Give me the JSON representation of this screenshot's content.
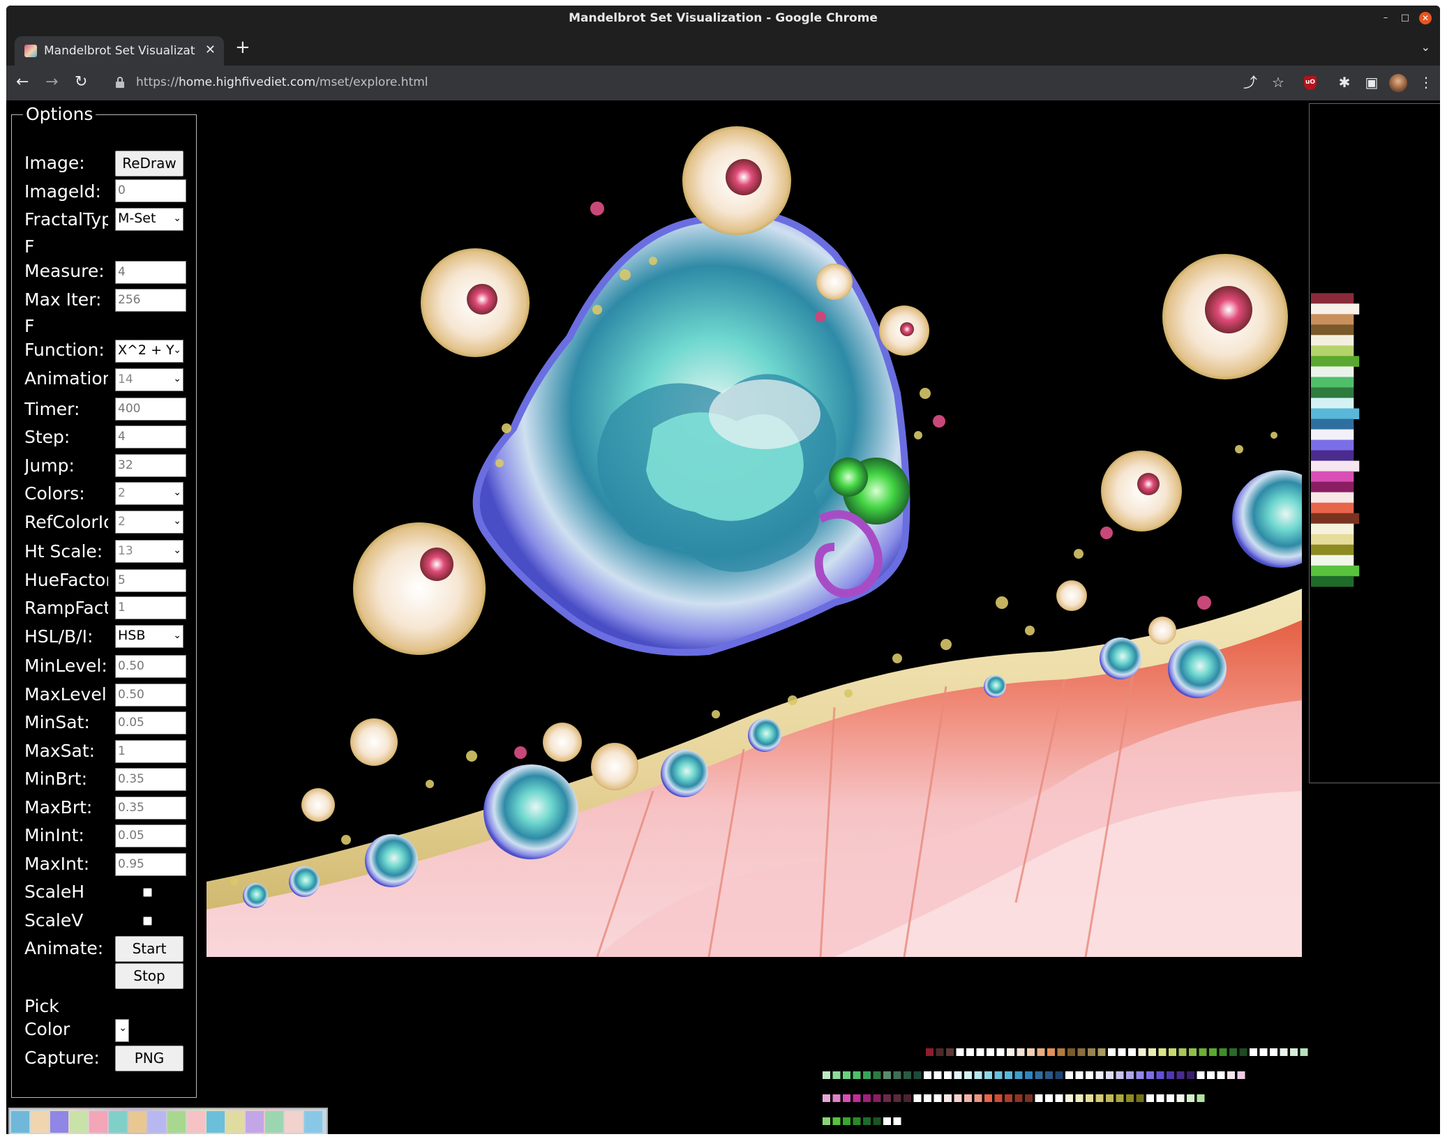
{
  "window": {
    "title": "Mandelbrot Set Visualization - Google Chrome",
    "controls": [
      "–",
      "□",
      "✕"
    ]
  },
  "tab": {
    "title": "Mandelbrot Set Visualizat",
    "close_glyph": "✕",
    "new_tab_glyph": "+",
    "menu_glyph": "⌄"
  },
  "toolbar": {
    "url_scheme": "https://",
    "url_host": "home.highfivediet.com",
    "url_path": "/mset/explore.html",
    "back_glyph": "←",
    "forward_glyph": "→",
    "reload_glyph": "↻",
    "share_glyph": "⤴",
    "star_glyph": "☆",
    "extensions_glyph": "✱",
    "sidepanel_glyph": "▣",
    "menu_glyph": "⋮",
    "ublock_text": "uO"
  },
  "options": {
    "legend": "Options",
    "image_label": "Image:",
    "redraw_label": "ReDraw",
    "image_id_label": "ImageId:",
    "image_id_value": "0",
    "fractal_type_label": "FractalType",
    "fractal_type_value": "M-Set",
    "f_measure_label_1": "F",
    "f_measure_label_2": "Measure:",
    "f_measure_value": "4",
    "max_iter_label": "Max Iter:",
    "max_iter_value": "256",
    "f_function_label_1": "F",
    "f_function_label_2": "Function:",
    "f_function_value": "X^2 + Y",
    "animation_label": "Animation",
    "animation_value": "14",
    "timer_label": "Timer:",
    "timer_value": "400",
    "step_label": "Step:",
    "step_value": "4",
    "jump_label": "Jump:",
    "jump_value": "32",
    "colors_label": "Colors:",
    "colors_value": "2",
    "ref_color_label": "RefColorId",
    "ref_color_value": "2",
    "ht_scale_label": "Ht Scale:",
    "ht_scale_value": "13",
    "hue_factor_label": "HueFactor",
    "hue_factor_value": "5",
    "ramp_factor_label": "RampFactor",
    "ramp_factor_value": "1",
    "hsl_label": "HSL/B/I:",
    "hsl_value": "HSB",
    "min_level_label": "MinLevel:",
    "min_level_value": "0.50",
    "max_level_label": "MaxLevel",
    "max_level_value": "0.50",
    "min_sat_label": "MinSat:",
    "min_sat_value": "0.05",
    "max_sat_label": "MaxSat:",
    "max_sat_value": "1",
    "min_brt_label": "MinBrt:",
    "min_brt_value": "0.35",
    "max_brt_label": "MaxBrt:",
    "max_brt_value": "0.35",
    "min_int_label": "MinInt:",
    "min_int_value": "0.05",
    "max_int_label": "MaxInt:",
    "max_int_value": "0.95",
    "scale_h_label": "ScaleH",
    "scale_v_label": "ScaleV",
    "animate_label": "Animate:",
    "start_label": "Start",
    "stop_label": "Stop",
    "pick_label_1": "Pick",
    "pick_label_2": "Color",
    "capture_label": "Capture:",
    "png_label": "PNG"
  },
  "colors": {
    "chrome_dark": "#1f1f1f",
    "chrome_toolbar": "#35363a",
    "page_bg": "#000000",
    "close_button": "#e95420"
  },
  "palette_ramp": [
    "#8b2a3a",
    "#f7f1ea",
    "#c9905c",
    "#7a5a2a",
    "#f4f0e0",
    "#b5d36b",
    "#5aa82f",
    "#eaf3ea",
    "#4fbf6a",
    "#2f7a3f",
    "#d4f2f4",
    "#59b8d9",
    "#2f6fa0",
    "#f2f0f8",
    "#7b6ee6",
    "#4a2b8e",
    "#f5e6f0",
    "#d94fb5",
    "#8a1e62",
    "#f7e8e6",
    "#e8644a",
    "#7a3320",
    "#f6f2dc",
    "#e6dc9a",
    "#8e8a22",
    "#f0f6ea",
    "#58c23f",
    "#1e6b2a"
  ],
  "swatch_rows": [
    [
      "#8f1d2c",
      "#4a2a2a",
      "#5c3838",
      "#fff",
      "#fff",
      "#fff",
      "#fff",
      "#fff",
      "#f7f1ea",
      "#f2e2d4",
      "#f0cdb3",
      "#e8ac7f",
      "#e09057",
      "#b07b3c",
      "#7a5a2a",
      "#8a6e3c",
      "#9a8350",
      "#a89a5f",
      "#fff",
      "#fff",
      "#fff",
      "#f4f0d6",
      "#e9ebb0",
      "#d9e58a",
      "#c6d86b",
      "#a8c45a",
      "#8fbf4a",
      "#6cae34",
      "#5aa82f",
      "#3e8e2a",
      "#2a6a2a",
      "#1e4a22",
      "#fff",
      "#fff",
      "#fff",
      "#eaf3ea",
      "#d6ecd8",
      "#b6e0bc"
    ],
    [
      "#bfe8c4",
      "#8fdd99",
      "#6ad27c",
      "#4fbf6a",
      "#38a45a",
      "#2f7a3f",
      "#5a8a6a",
      "#3e6e56",
      "#2a5a44",
      "#1e4a3a",
      "#fff",
      "#fff",
      "#fff",
      "#e6f6f8",
      "#d4f2f4",
      "#b6e6ee",
      "#8ed6e6",
      "#6ac0db",
      "#59b8d9",
      "#3f9ecb",
      "#2f86bf",
      "#2f6fa0",
      "#2a5a8a",
      "#1e4470",
      "#fff",
      "#fff",
      "#fff",
      "#f2f0f8",
      "#e0dcf4",
      "#c8c2ee",
      "#aea4ea",
      "#9486e8",
      "#7b6ee6",
      "#6450d6",
      "#5038b0",
      "#4a2b8e",
      "#3a1e6e",
      "#fff",
      "#fff",
      "#fff",
      "#f5e6f0",
      "#efcde4"
    ],
    [
      "#e8a6d6",
      "#df82c8",
      "#d94fb5",
      "#c02e98",
      "#a3207c",
      "#8a1e62",
      "#6a2a4a",
      "#5a2a3a",
      "#4a2430",
      "#fff",
      "#fff",
      "#fff",
      "#f7e8e6",
      "#f2d2cc",
      "#f0b4a8",
      "#ec9682",
      "#e8644a",
      "#d04c34",
      "#b03c28",
      "#8e3422",
      "#7a3320",
      "#fff",
      "#fff",
      "#fff",
      "#f6f2dc",
      "#f0eac0",
      "#e6dc9a",
      "#d4ca76",
      "#c0b85a",
      "#aaa640",
      "#8e8a22",
      "#767214",
      "#fff",
      "#fff",
      "#fff",
      "#f0f6ea",
      "#d4eec8",
      "#b4e2a0"
    ],
    [
      "#88d672",
      "#58c23f",
      "#3aa62c",
      "#2a8a26",
      "#1e6b2a",
      "#1a5426",
      "#fff",
      "#fff"
    ]
  ]
}
